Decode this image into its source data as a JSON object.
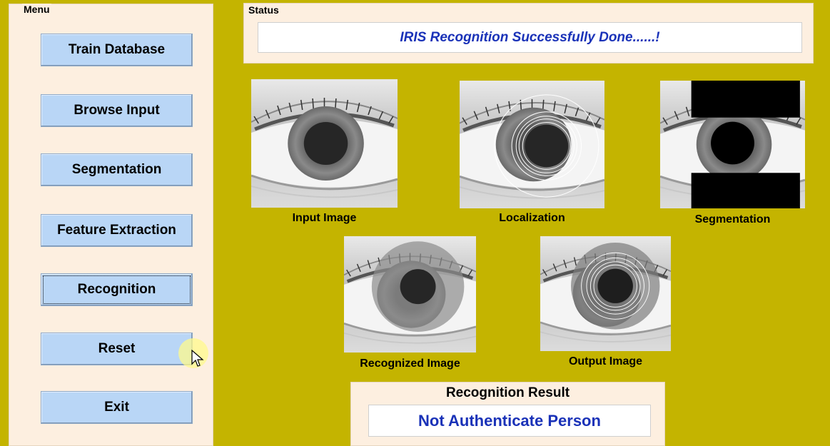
{
  "menu": {
    "title": "Menu",
    "buttons": [
      {
        "label": "Train Database"
      },
      {
        "label": "Browse Input"
      },
      {
        "label": "Segmentation"
      },
      {
        "label": "Feature Extraction"
      },
      {
        "label": "Recognition"
      },
      {
        "label": "Reset"
      },
      {
        "label": "Exit"
      }
    ]
  },
  "status": {
    "title": "Status",
    "message": "IRIS Recognition Successfully Done......!"
  },
  "images": {
    "input": {
      "caption": "Input Image"
    },
    "localization": {
      "caption": "Localization"
    },
    "segmentation": {
      "caption": "Segmentation"
    },
    "recognized": {
      "caption": "Recognized Image"
    },
    "output": {
      "caption": "Output Image"
    }
  },
  "result": {
    "title": "Recognition Result",
    "message": "Not Authenticate Person"
  },
  "colors": {
    "background": "#c4b400",
    "panel": "#fdefe0",
    "button": "#b9d6f6",
    "accent_text": "#1a32b8"
  }
}
